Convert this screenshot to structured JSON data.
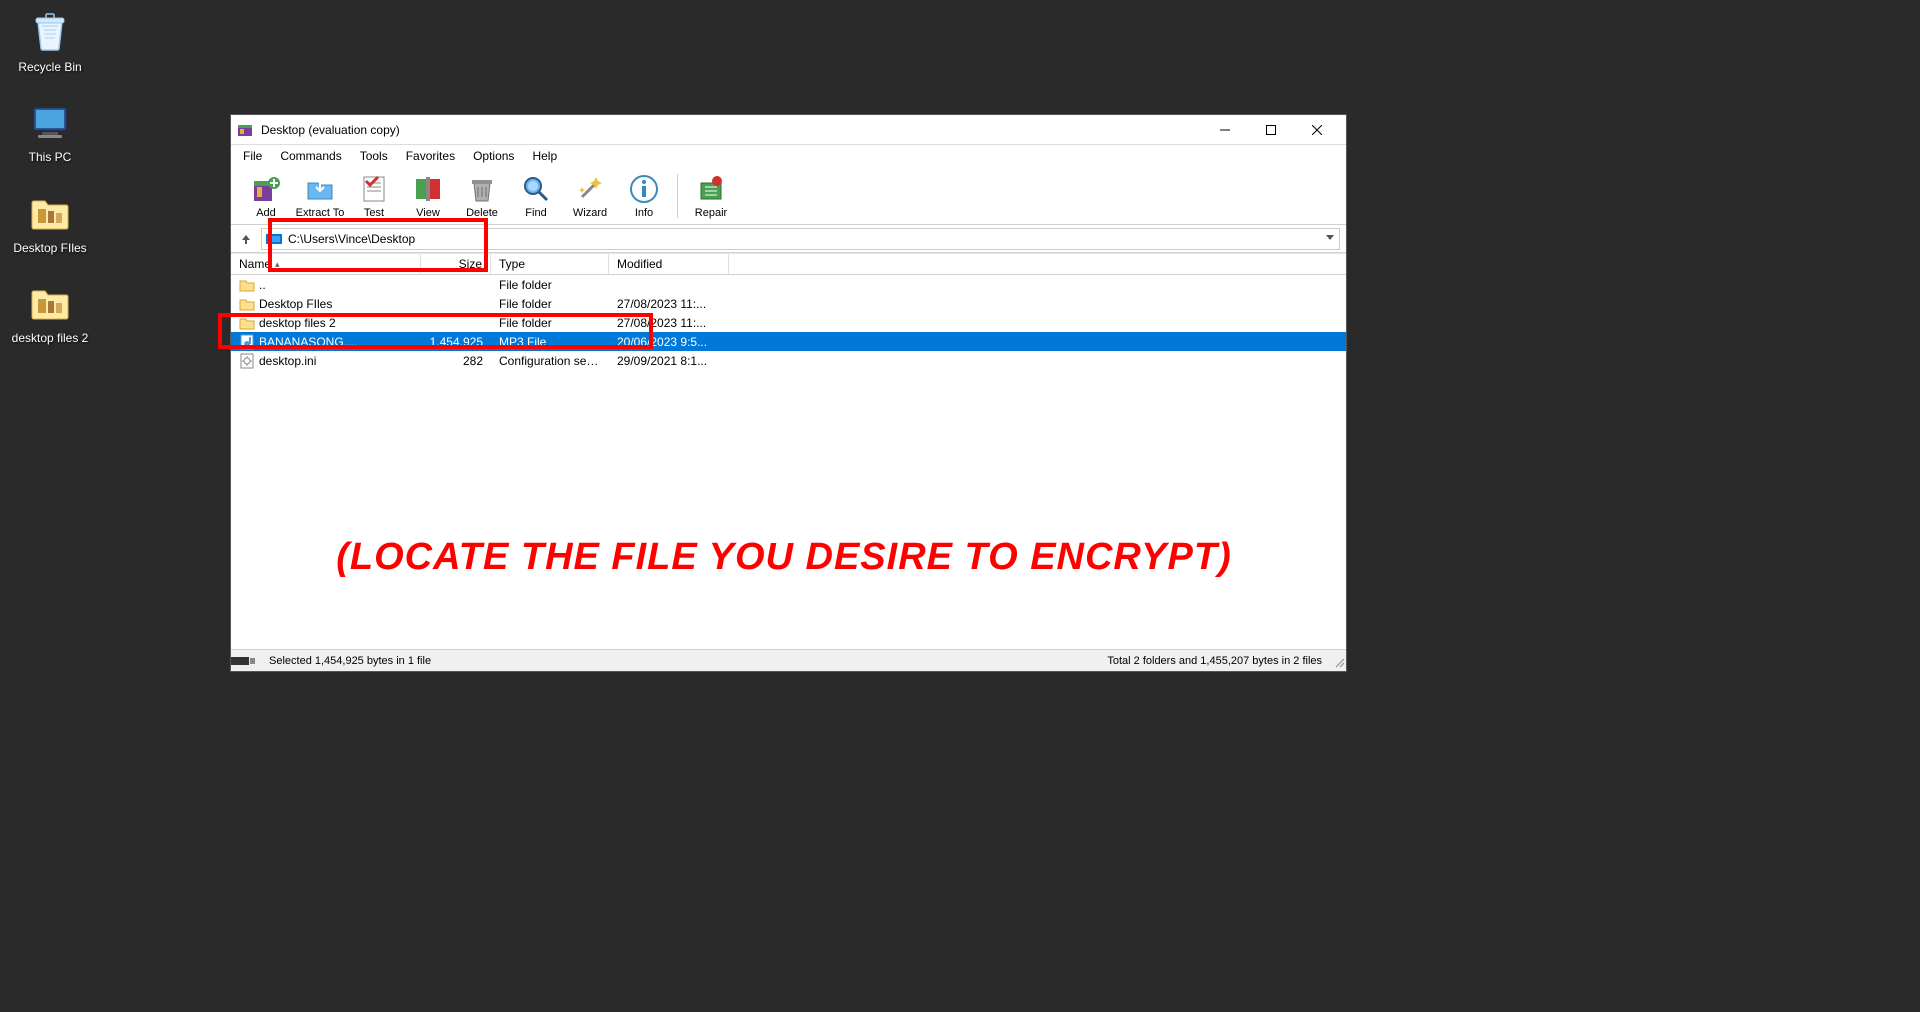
{
  "desktop": {
    "icons": [
      {
        "name": "recycle-bin",
        "label": "Recycle Bin"
      },
      {
        "name": "this-pc",
        "label": "This PC"
      },
      {
        "name": "desktop-files",
        "label": "Desktop FIles"
      },
      {
        "name": "desktop-files-2",
        "label": "desktop files 2"
      }
    ]
  },
  "window": {
    "title": "Desktop (evaluation copy)",
    "menus": [
      "File",
      "Commands",
      "Tools",
      "Favorites",
      "Options",
      "Help"
    ],
    "toolbar": [
      {
        "name": "add",
        "label": "Add"
      },
      {
        "name": "extract-to",
        "label": "Extract To"
      },
      {
        "name": "test",
        "label": "Test"
      },
      {
        "name": "view",
        "label": "View"
      },
      {
        "name": "delete",
        "label": "Delete"
      },
      {
        "name": "find",
        "label": "Find"
      },
      {
        "name": "wizard",
        "label": "Wizard"
      },
      {
        "name": "info",
        "label": "Info"
      },
      {
        "name": "repair",
        "label": "Repair"
      }
    ],
    "path": "C:\\Users\\Vince\\Desktop",
    "columns": {
      "name": "Name",
      "size": "Size",
      "type": "Type",
      "modified": "Modified"
    },
    "rows": [
      {
        "icon": "folder",
        "name": "..",
        "size": "",
        "type": "File folder",
        "modified": "",
        "selected": false
      },
      {
        "icon": "folder",
        "name": "Desktop FIles",
        "size": "",
        "type": "File folder",
        "modified": "27/08/2023 11:...",
        "selected": false
      },
      {
        "icon": "folder",
        "name": "desktop files 2",
        "size": "",
        "type": "File folder",
        "modified": "27/08/2023 11:...",
        "selected": false
      },
      {
        "icon": "mp3",
        "name": "BANANASONG....",
        "size": "1,454,925",
        "type": "MP3 File",
        "modified": "20/06/2023 9:5...",
        "selected": true
      },
      {
        "icon": "ini",
        "name": "desktop.ini",
        "size": "282",
        "type": "Configuration setti...",
        "modified": "29/09/2021 8:1...",
        "selected": false
      }
    ],
    "status_left": "Selected 1,454,925 bytes in 1 file",
    "status_right": "Total 2 folders and 1,455,207 bytes in 2 files"
  },
  "annotation": "(LOCATE THE FILE YOU DESIRE TO ENCRYPT)"
}
